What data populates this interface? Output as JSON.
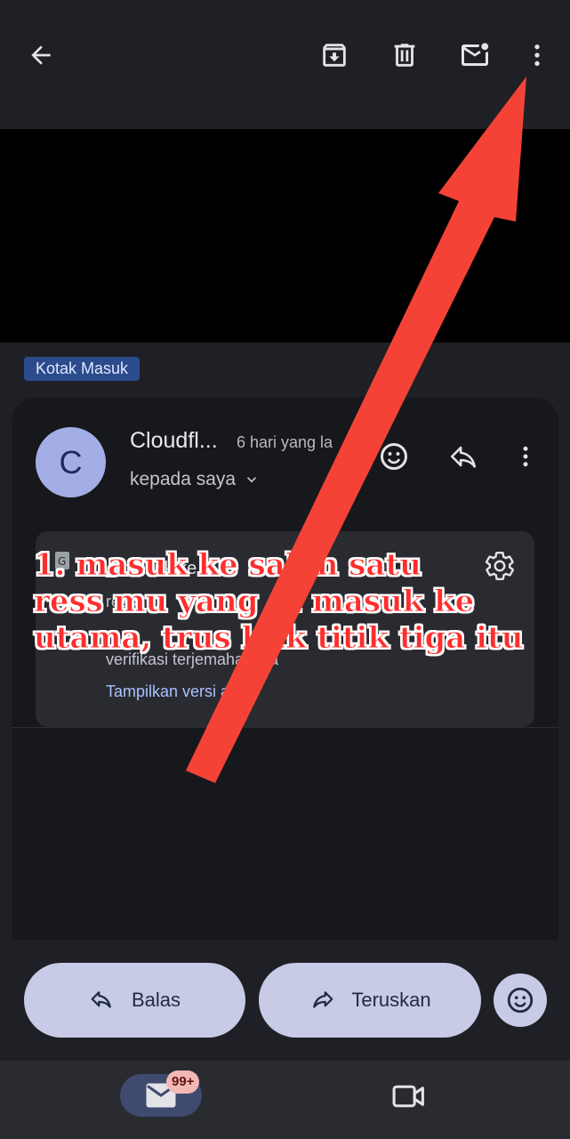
{
  "toolbar": {
    "back_icon": "arrow-left-icon",
    "archive_icon": "archive-icon",
    "delete_icon": "trash-icon",
    "mark_unread_icon": "mail-unread-icon",
    "more_icon": "more-vert-icon"
  },
  "label": "Kotak Masuk",
  "message": {
    "avatar_letter": "C",
    "sender": "Cloudfl...",
    "time": "6 hari yang la",
    "recipient": "kepada saya"
  },
  "translate_card": {
    "title_fragment": "_ masuk ke",
    "subtitle_fragment": "ress",
    "line2": "verifikasi terjemahannya",
    "link": "Tampilkan versi asli"
  },
  "actions": {
    "reply": "Balas",
    "forward": "Teruskan"
  },
  "nav": {
    "mail_badge": "99+"
  },
  "annotation": {
    "text": "1. masuk ke salah satu\nress mu yang di masuk ke\nutama, trus klik titik tiga itu",
    "color": "#ff2d2d"
  },
  "colors": {
    "background": "#1f2025",
    "accent_pill": "#c7cbe6",
    "label_chip": "#2b4b8c",
    "arrow": "#f44336"
  }
}
